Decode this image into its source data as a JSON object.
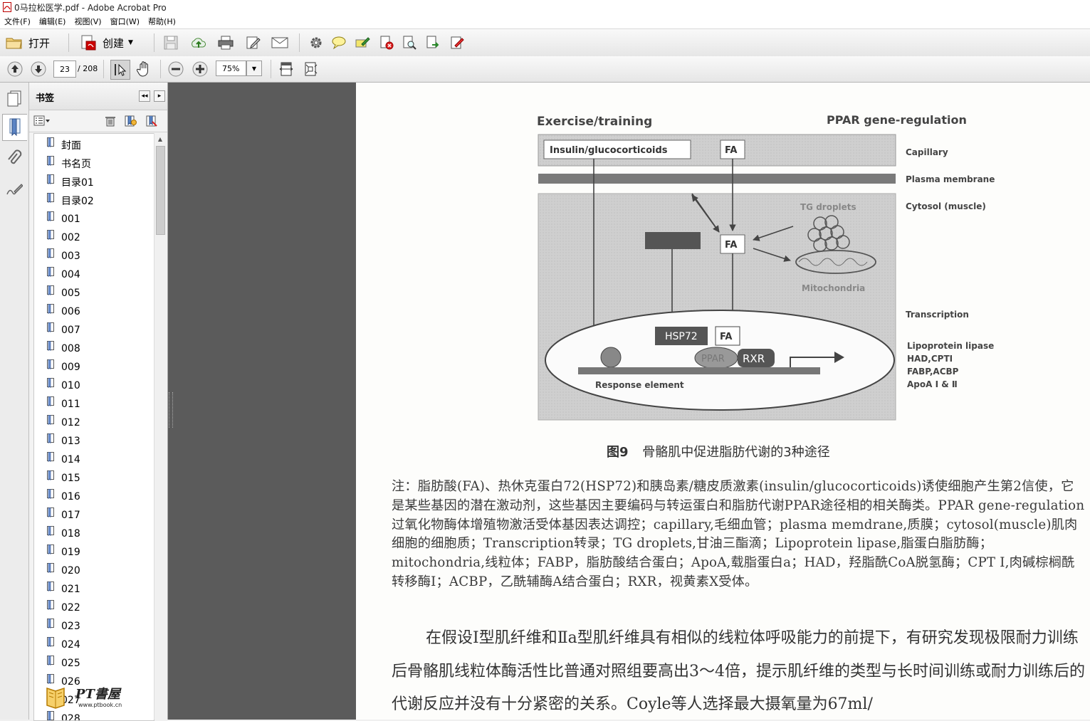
{
  "window": {
    "title": "0马拉松医学.pdf - Adobe Acrobat Pro"
  },
  "menu": [
    "文件(F)",
    "编辑(E)",
    "视图(V)",
    "窗口(W)",
    "帮助(H)"
  ],
  "toolbar": {
    "open_label": "打开",
    "create_label": "创建"
  },
  "nav": {
    "current_page": "23",
    "total_pages": "/ 208",
    "zoom": "75%"
  },
  "bookmarks": {
    "title": "书签",
    "items": [
      "封面",
      "书名页",
      "目录01",
      "目录02",
      "001",
      "002",
      "003",
      "004",
      "005",
      "006",
      "007",
      "008",
      "009",
      "010",
      "011",
      "012",
      "013",
      "014",
      "015",
      "016",
      "017",
      "018",
      "019",
      "020",
      "021",
      "022",
      "023",
      "024",
      "025",
      "026",
      "027",
      "028"
    ]
  },
  "figure": {
    "title_left": "Exercise/training",
    "title_right": "PPAR gene-regulation",
    "box_insulin": "Insulin/glucocorticoids",
    "box_fa": "FA",
    "label_capillary": "Capillary",
    "label_membrane": "Plasma membrane",
    "label_cytosol": "Cytosol (muscle)",
    "label_tg": "TG droplets",
    "label_mito": "Mitochondria",
    "label_transcription": "Transcription",
    "label_genes": [
      "Lipoprotein lipase",
      "HAD,CPTI",
      "FABP,ACBP",
      "ApoA Ⅰ & Ⅱ"
    ],
    "hsp": "HSP72",
    "ppar": "PPAR",
    "rxr": "RXR",
    "response": "Response element"
  },
  "caption": {
    "num": "图9",
    "text": "骨骼肌中促进脂肪代谢的3种途径"
  },
  "note": "注：脂肪酸(FA)、热休克蛋白72(HSP72)和胰岛素/糖皮质激素(insulin/glucocorticoids)诱使细胞产生第2信使，它是某些基因的潜在激动剂，这些基因主要编码与转运蛋白和脂肪代谢PPAR途径相的相关酶类。PPAR gene-regulation过氧化物酶体增殖物激活受体基因表达调控；capillary,毛细血管；plasma memdrane,质膜；cytosol(muscle)肌肉细胞的细胞质；Transcription转录；TG droplets,甘油三酯滴；Lipoprotein lipase,脂蛋白脂肪酶；mitochondria,线粒体；FABP，脂肪酸结合蛋白；ApoA,载脂蛋白a；HAD，羟脂酰CoA脱氢酶；CPT Ⅰ,肉碱棕榈酰转移酶Ⅰ；ACBP，乙酰辅酶A结合蛋白；RXR，视黄素X受体。",
  "body": "在假设Ⅰ型肌纤维和Ⅱa型肌纤维具有相似的线粒体呼吸能力的前提下，有研究发现极限耐力训练后骨骼肌线粒体酶活性比普通对照组要高出3～4倍，提示肌纤维的类型与长时间训练或耐力训练后的代谢反应并没有十分紧密的关系。Coyle等人选择最大摄氧量为67ml/",
  "watermark": {
    "brand": "PT書屋",
    "url": "www.ptbook.cn"
  }
}
